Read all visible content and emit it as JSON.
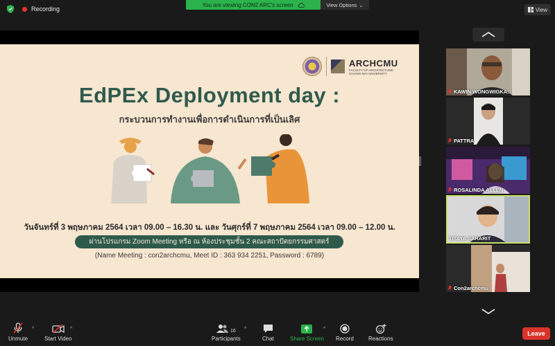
{
  "topbar": {
    "recording_label": "Recording",
    "share_banner_text": "You are viewing CON2 ARC's screen",
    "view_options_label": "View Options",
    "view_button_label": "View"
  },
  "slide": {
    "arch_name": "ARCHCMU",
    "arch_sub1": "FACULTY OF ARCHITECTURE",
    "arch_sub2": "CHIANG MAI UNIVERSITY",
    "title": "EdPEx Deployment day :",
    "subtitle": "กระบวนการทำงานเพื่อการดำเนินการที่เป็นเลิศ",
    "dates": "วันจันทร์ที่ 3 พฤษภาคม 2564 เวลา 09.00 – 16.30 น. และ วันศุกร์ที่ 7 พฤษภาคม 2564 เวลา 09.00 – 12.00 น.",
    "venue": "ผ่านโปรแกรม Zoom Meeting หรือ ณ ห้องประชุมชั้น 2 คณะสถาปัตยกรรมศาสตร์",
    "meeting_info": "(Name Meeting : con2archcmu, Meet ID : 363 934 2251, Password : 6789)"
  },
  "participants_gallery": [
    {
      "name": "KAWIN WONGWIGKA...",
      "muted": true
    },
    {
      "name": "PATTRA",
      "muted": true
    },
    {
      "name": "ROSALINDA ALLEN",
      "muted": true
    },
    {
      "name": "TITAYA SARARIT",
      "muted": false
    },
    {
      "name": "Con2archcmu",
      "muted": true
    }
  ],
  "toolbar": {
    "unmute": "Unmute",
    "start_video": "Start Video",
    "participants": "Participants",
    "participants_count": "16",
    "chat": "Chat",
    "share_screen": "Share Screen",
    "record": "Record",
    "reactions": "Reactions",
    "leave": "Leave"
  },
  "colors": {
    "accent_green": "#2bb24c",
    "leave_red": "#d9342b",
    "slide_bg": "#f7e6d0",
    "title_green": "#2e5a4c",
    "active_speaker": "#c8e06a"
  }
}
